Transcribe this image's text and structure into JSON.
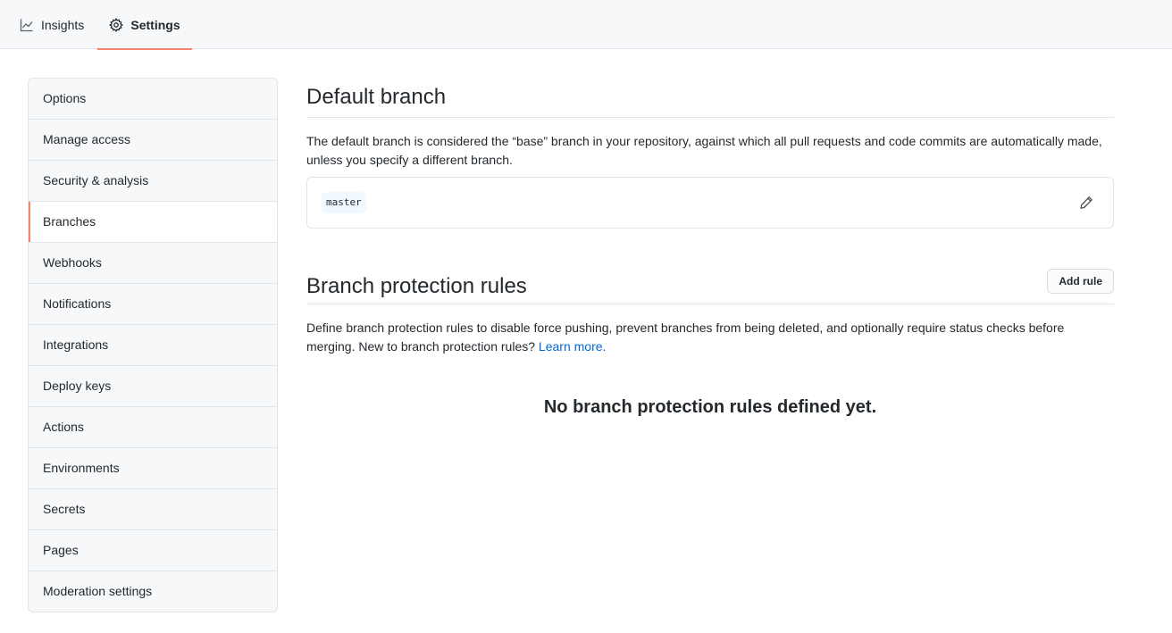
{
  "tabs": {
    "insights": "Insights",
    "settings": "Settings"
  },
  "sidebar": {
    "items": [
      {
        "label": "Options"
      },
      {
        "label": "Manage access"
      },
      {
        "label": "Security & analysis"
      },
      {
        "label": "Branches",
        "active": true
      },
      {
        "label": "Webhooks"
      },
      {
        "label": "Notifications"
      },
      {
        "label": "Integrations"
      },
      {
        "label": "Deploy keys"
      },
      {
        "label": "Actions"
      },
      {
        "label": "Environments"
      },
      {
        "label": "Secrets"
      },
      {
        "label": "Pages"
      },
      {
        "label": "Moderation settings"
      }
    ]
  },
  "default_branch": {
    "title": "Default branch",
    "description": "The default branch is considered the “base” branch in your repository, against which all pull requests and code commits are automatically made, unless you specify a different branch.",
    "branch_name": "master"
  },
  "protection": {
    "title": "Branch protection rules",
    "add_button": "Add rule",
    "description": "Define branch protection rules to disable force pushing, prevent branches from being deleted, and optionally require status checks before merging. New to branch protection rules?",
    "learn_more": "Learn more.",
    "empty_message": "No branch protection rules defined yet."
  },
  "colors": {
    "accent": "#f9826c",
    "link": "#0366d6"
  }
}
